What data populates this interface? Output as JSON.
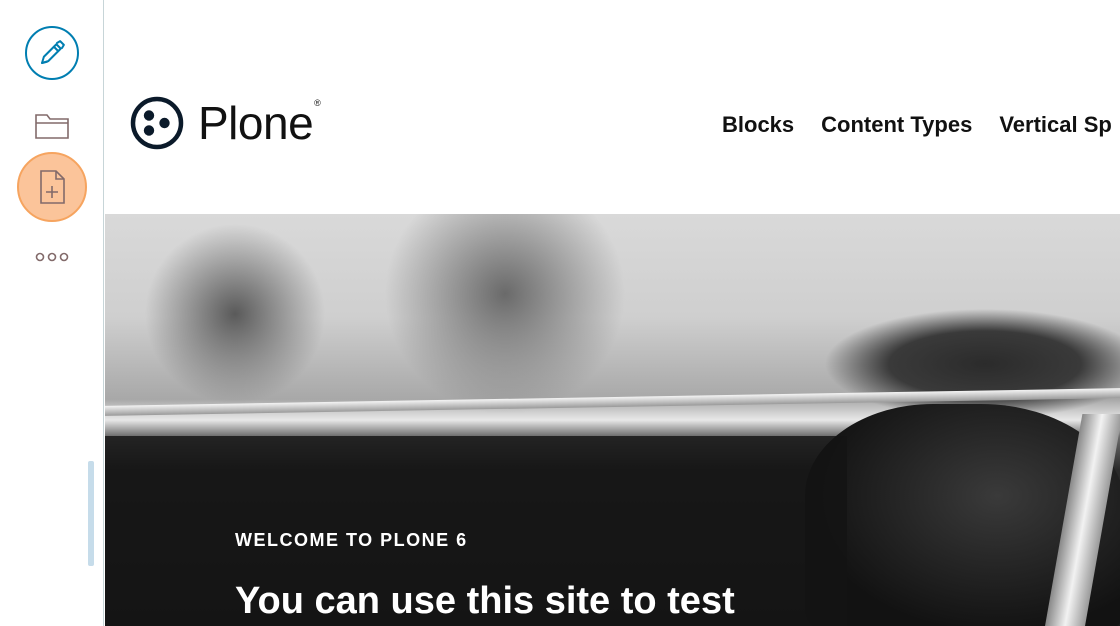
{
  "toolbar": {
    "items": [
      {
        "icon": "pencil-icon",
        "label": "Edit"
      },
      {
        "icon": "folder-icon",
        "label": "Contents"
      },
      {
        "icon": "add-document-icon",
        "label": "Add"
      },
      {
        "icon": "more-icon",
        "label": "More"
      }
    ],
    "accent_color": "#007eb1",
    "add_highlight_color": "#fbc49a"
  },
  "header": {
    "logo_text": "Plone",
    "logo_reg_mark": "®",
    "nav": [
      {
        "label": "Blocks"
      },
      {
        "label": "Content Types"
      },
      {
        "label": "Vertical Sp"
      }
    ]
  },
  "hero": {
    "kicker": "WELCOME TO PLONE 6",
    "title": "You can use this site to test"
  }
}
